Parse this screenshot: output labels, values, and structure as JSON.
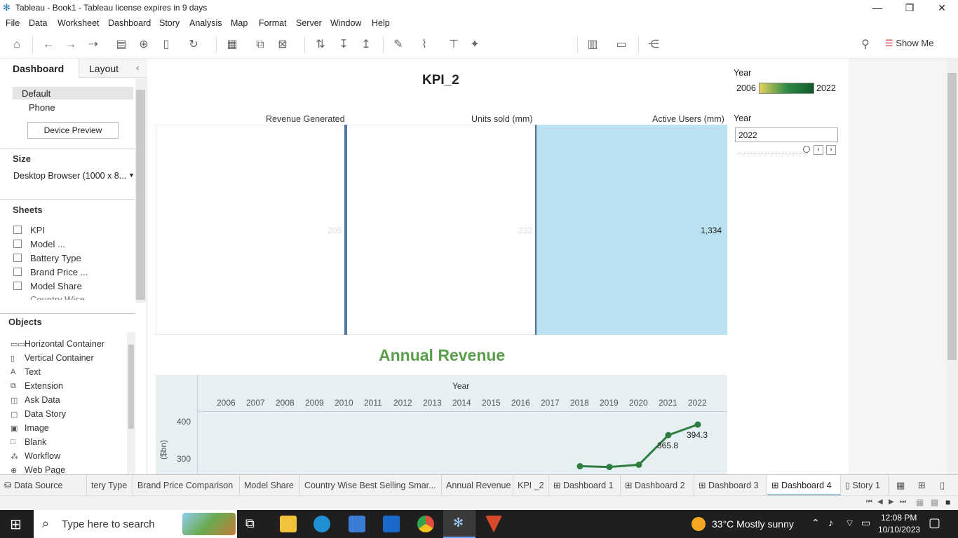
{
  "window": {
    "title": "Tableau - Book1 - Tableau license expires in 9 days"
  },
  "menu": [
    "File",
    "Data",
    "Worksheet",
    "Dashboard",
    "Story",
    "Analysis",
    "Map",
    "Format",
    "Server",
    "Window",
    "Help"
  ],
  "toolbar": {
    "show_me": "Show Me"
  },
  "left_panel": {
    "tabs": [
      "Dashboard",
      "Layout"
    ],
    "devices": [
      "Default",
      "Phone"
    ],
    "device_preview": "Device Preview",
    "size_heading": "Size",
    "size_value": "Desktop Browser (1000 x 8...",
    "sheets_heading": "Sheets",
    "sheets": [
      "KPI",
      "Model ...",
      "Battery Type",
      "Brand Price ...",
      "Model Share",
      "Country Wise"
    ],
    "objects_heading": "Objects",
    "objects": [
      {
        "label": "Horizontal Container",
        "icon": "horizontal-container-icon",
        "glyph": "▭▭"
      },
      {
        "label": "Vertical Container",
        "icon": "vertical-container-icon",
        "glyph": "▯"
      },
      {
        "label": "Text",
        "icon": "text-icon",
        "glyph": "A"
      },
      {
        "label": "Extension",
        "icon": "extension-icon",
        "glyph": "⧉"
      },
      {
        "label": "Ask Data",
        "icon": "ask-data-icon",
        "glyph": "◫"
      },
      {
        "label": "Data Story",
        "icon": "data-story-icon",
        "glyph": "▢"
      },
      {
        "label": "Image",
        "icon": "image-icon",
        "glyph": "▣"
      },
      {
        "label": "Blank",
        "icon": "blank-icon",
        "glyph": "□"
      },
      {
        "label": "Workflow",
        "icon": "workflow-icon",
        "glyph": "⁂"
      },
      {
        "label": "Web Page",
        "icon": "web-page-icon",
        "glyph": "⊕"
      }
    ]
  },
  "dashboard": {
    "kpi_title": "KPI_2",
    "kpi_headers": [
      "Revenue Generated",
      "Units sold (mm)",
      "Active Users (mm)"
    ],
    "kpi_values": [
      "205",
      "232",
      "1,334"
    ],
    "legend_title": "Year",
    "legend_min": "2006",
    "legend_max": "2022",
    "filter_title": "Year",
    "filter_value": "2022",
    "revenue_title": "Annual Revenue",
    "accent": "#5a9e4b",
    "kpi_fill": "#b9e1f0"
  },
  "chart_data": {
    "type": "line",
    "title": "Annual Revenue",
    "xlabel": "Year",
    "ylabel": "($bn)",
    "x": [
      "2006",
      "2007",
      "2008",
      "2009",
      "2010",
      "2011",
      "2012",
      "2013",
      "2014",
      "2015",
      "2016",
      "2017",
      "2018",
      "2019",
      "2020",
      "2021",
      "2022"
    ],
    "points": [
      {
        "x": "2018",
        "y": 282
      },
      {
        "x": "2019",
        "y": 280
      },
      {
        "x": "2020",
        "y": 286
      },
      {
        "x": "2021",
        "y": 365.8
      },
      {
        "x": "2022",
        "y": 394.3
      }
    ],
    "data_labels": [
      "365.8",
      "394.3"
    ],
    "yticks": [
      "400",
      "300"
    ],
    "color": "#2e7d3e"
  },
  "sheet_tabs": [
    {
      "label": "Data Source",
      "icon": "data-source-icon"
    },
    {
      "label": "tery Type"
    },
    {
      "label": "Brand Price Comparison"
    },
    {
      "label": "Model Share"
    },
    {
      "label": "Country Wise Best Selling Smar..."
    },
    {
      "label": "Annual Revenue"
    },
    {
      "label": "KPI _2"
    },
    {
      "label": "Dashboard 1"
    },
    {
      "label": "Dashboard 2"
    },
    {
      "label": "Dashboard 3"
    },
    {
      "label": "Dashboard 4",
      "active": true
    },
    {
      "label": "Story 1"
    }
  ],
  "taskbar": {
    "search_placeholder": "Type here to search",
    "weather": "33°C  Mostly sunny",
    "time": "12:08 PM",
    "date": "10/10/2023"
  }
}
